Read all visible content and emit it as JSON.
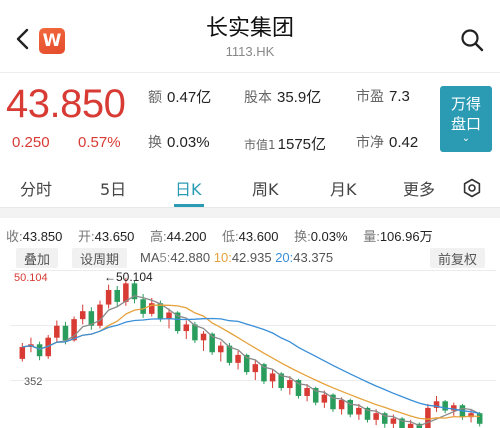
{
  "header": {
    "title": "长实集团",
    "code": "1113.HK",
    "app_badge": "W",
    "icons": {
      "back": "chevron-left-icon",
      "search": "search-icon"
    }
  },
  "quote": {
    "price": "43.850",
    "change": "0.250",
    "change_pct": "0.57%",
    "color_up": "#d83a34",
    "stats": {
      "amount_label": "额",
      "amount": "0.47亿",
      "share_label": "股本",
      "share": "35.9亿",
      "pe_label": "市盈",
      "pe": "7.3",
      "turnover_label": "换",
      "turnover": "0.03%",
      "mcap_label": "市值1",
      "mcap": "1575亿",
      "pb_label": "市净",
      "pb": "0.42"
    },
    "rank_button": {
      "line1": "万得",
      "line2": "盘口",
      "chevron": "⌄",
      "color": "#2b9bb4"
    }
  },
  "tabs": {
    "items": [
      "分时",
      "5日",
      "日K",
      "周K",
      "月K",
      "更多"
    ],
    "active": "日K",
    "settings_icon": "gear-icon",
    "accent": "#2b9bb4"
  },
  "summary": {
    "close_label": "收:",
    "close": "43.850",
    "open_label": "开:",
    "open": "43.650",
    "high_label": "高:",
    "high": "44.200",
    "low_label": "低:",
    "low": "43.600",
    "turn_label": "换:",
    "turn": "0.03%",
    "vol_label": "量:",
    "vol": "106.96万"
  },
  "chart_controls": {
    "overlay": "叠加",
    "set_period": "设周期",
    "ma_label": "MA",
    "ma5_key": "5:",
    "ma5": "42.880",
    "ma10_key": "10:",
    "ma10": "42.935",
    "ma20_key": "20:",
    "ma20": "43.375",
    "adjust": "前复权"
  },
  "chart_data": {
    "type": "candlestick",
    "y_top_label": "50.104",
    "y_mid_label": "352",
    "max_marker": "←50.104",
    "ma_colors": {
      "ma5": "#8a8a8a",
      "ma10": "#e6a23c",
      "ma20": "#3a8fd8"
    },
    "up_color": "#d83a34",
    "down_color": "#2a9d5c",
    "candles": [
      [
        44.0,
        45.2,
        43.8,
        44.9
      ],
      [
        44.9,
        45.6,
        44.5,
        45.1
      ],
      [
        45.1,
        45.3,
        43.9,
        44.2
      ],
      [
        44.2,
        45.8,
        44.0,
        45.6
      ],
      [
        45.6,
        46.9,
        45.2,
        46.5
      ],
      [
        46.5,
        46.8,
        45.1,
        45.4
      ],
      [
        45.4,
        47.2,
        45.3,
        47.0
      ],
      [
        47.0,
        48.1,
        46.6,
        47.6
      ],
      [
        47.6,
        47.9,
        46.2,
        46.5
      ],
      [
        46.5,
        48.4,
        46.3,
        48.1
      ],
      [
        48.1,
        49.6,
        47.8,
        49.2
      ],
      [
        49.2,
        49.5,
        47.9,
        48.3
      ],
      [
        48.3,
        50.104,
        48.0,
        49.7
      ],
      [
        49.7,
        49.9,
        48.2,
        48.5
      ],
      [
        48.5,
        48.9,
        47.1,
        47.4
      ],
      [
        47.4,
        48.6,
        47.2,
        48.2
      ],
      [
        48.2,
        48.4,
        46.8,
        47.0
      ],
      [
        47.0,
        47.8,
        46.3,
        47.5
      ],
      [
        47.5,
        47.6,
        45.9,
        46.1
      ],
      [
        46.1,
        46.9,
        45.5,
        46.6
      ],
      [
        46.6,
        46.8,
        45.2,
        45.4
      ],
      [
        45.4,
        46.1,
        44.6,
        45.9
      ],
      [
        45.9,
        46.0,
        44.3,
        44.5
      ],
      [
        44.5,
        45.3,
        43.8,
        45.0
      ],
      [
        45.0,
        45.2,
        43.5,
        43.7
      ],
      [
        43.7,
        44.6,
        43.2,
        44.3
      ],
      [
        44.3,
        44.4,
        42.8,
        43.0
      ],
      [
        43.0,
        43.9,
        42.4,
        43.6
      ],
      [
        43.6,
        43.7,
        42.1,
        42.3
      ],
      [
        42.3,
        43.2,
        41.8,
        42.9
      ],
      [
        42.9,
        43.0,
        41.6,
        41.8
      ],
      [
        41.8,
        42.7,
        41.3,
        42.4
      ],
      [
        42.4,
        42.5,
        41.0,
        41.2
      ],
      [
        41.2,
        42.1,
        40.8,
        41.8
      ],
      [
        41.8,
        41.9,
        40.5,
        40.7
      ],
      [
        40.7,
        41.6,
        40.3,
        41.3
      ],
      [
        41.3,
        41.4,
        40.0,
        40.2
      ],
      [
        40.2,
        41.1,
        39.8,
        40.9
      ],
      [
        40.9,
        41.0,
        39.6,
        39.8
      ],
      [
        39.8,
        40.6,
        39.4,
        40.3
      ],
      [
        40.3,
        40.4,
        39.2,
        39.4
      ],
      [
        39.4,
        40.2,
        39.0,
        39.9
      ],
      [
        39.9,
        40.0,
        38.8,
        39.1
      ],
      [
        39.1,
        39.8,
        38.6,
        39.5
      ],
      [
        39.5,
        39.6,
        38.5,
        38.7
      ],
      [
        38.7,
        39.4,
        38.3,
        39.1
      ],
      [
        39.1,
        39.2,
        38.1,
        38.4
      ],
      [
        38.4,
        40.6,
        38.3,
        40.3
      ],
      [
        40.3,
        41.2,
        40.0,
        40.8
      ],
      [
        40.8,
        40.9,
        39.9,
        40.1
      ],
      [
        40.1,
        40.7,
        39.7,
        40.5
      ],
      [
        40.5,
        40.6,
        39.4,
        39.6
      ],
      [
        39.6,
        40.2,
        39.2,
        39.9
      ],
      [
        39.9,
        40.0,
        38.9,
        39.1
      ]
    ]
  }
}
